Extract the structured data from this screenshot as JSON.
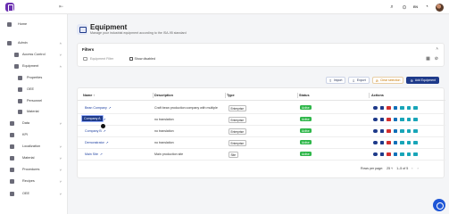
{
  "header": {
    "language": "EN"
  },
  "sidebar": {
    "items": [
      {
        "label": "Home",
        "icon": "home-icon"
      },
      {
        "label": "Admin",
        "icon": "admin-icon"
      },
      {
        "label": "Access Control",
        "icon": "lock-icon"
      },
      {
        "label": "Equipment",
        "icon": "equipment-icon"
      },
      {
        "label": "Properties",
        "icon": "properties-icon"
      },
      {
        "label": "OEE",
        "icon": "oee-icon"
      },
      {
        "label": "Personnel",
        "icon": "personnel-icon"
      },
      {
        "label": "Material",
        "icon": "material-icon"
      },
      {
        "label": "Data",
        "icon": "data-icon"
      },
      {
        "label": "KPI",
        "icon": "kpi-icon"
      },
      {
        "label": "Localization",
        "icon": "localization-icon"
      },
      {
        "label": "Material",
        "icon": "material-icon"
      },
      {
        "label": "Procedures",
        "icon": "procedures-icon"
      },
      {
        "label": "Recipes",
        "icon": "recipes-icon"
      },
      {
        "label": "OEE",
        "icon": "oee-icon"
      }
    ]
  },
  "page": {
    "title": "Equipment",
    "subtitle": "Manage your industrial equipment according to the ISA-95 standard"
  },
  "filters": {
    "title": "Filters",
    "equipment_filter_placeholder": "Equipment Filter",
    "show_disabled_label": "Show disabled"
  },
  "toolbar": {
    "import": "Import",
    "export": "Export",
    "clear_selection": "Clear selection",
    "add": "Add Equipment"
  },
  "table": {
    "columns": [
      "Name",
      "Description",
      "Type",
      "Status",
      "Actions"
    ],
    "rows": [
      {
        "name": "Bean Company",
        "description": "Craft bean production company with multiple",
        "type": "Enterprise",
        "status": "Active"
      },
      {
        "name": "Company A",
        "description": "no translation",
        "type": "Enterprise",
        "status": "Active"
      },
      {
        "name": "Company B",
        "description": "no translation",
        "type": "Enterprise",
        "status": "Active"
      },
      {
        "name": "Demonstrator",
        "description": "no translation",
        "type": "Enterprise",
        "status": "Active"
      },
      {
        "name": "Main Site",
        "description": "Main production site",
        "type": "Site",
        "status": "Active"
      }
    ]
  },
  "tooltip": {
    "text": "Company A"
  },
  "pagination": {
    "rows_per_page_label": "Rows per page:",
    "rows_per_page": "25",
    "range": "1–5 of 5"
  },
  "colors": {
    "accent": "#1e3a8a",
    "active": "#2fb74a",
    "brand": "#6a2fb0"
  }
}
